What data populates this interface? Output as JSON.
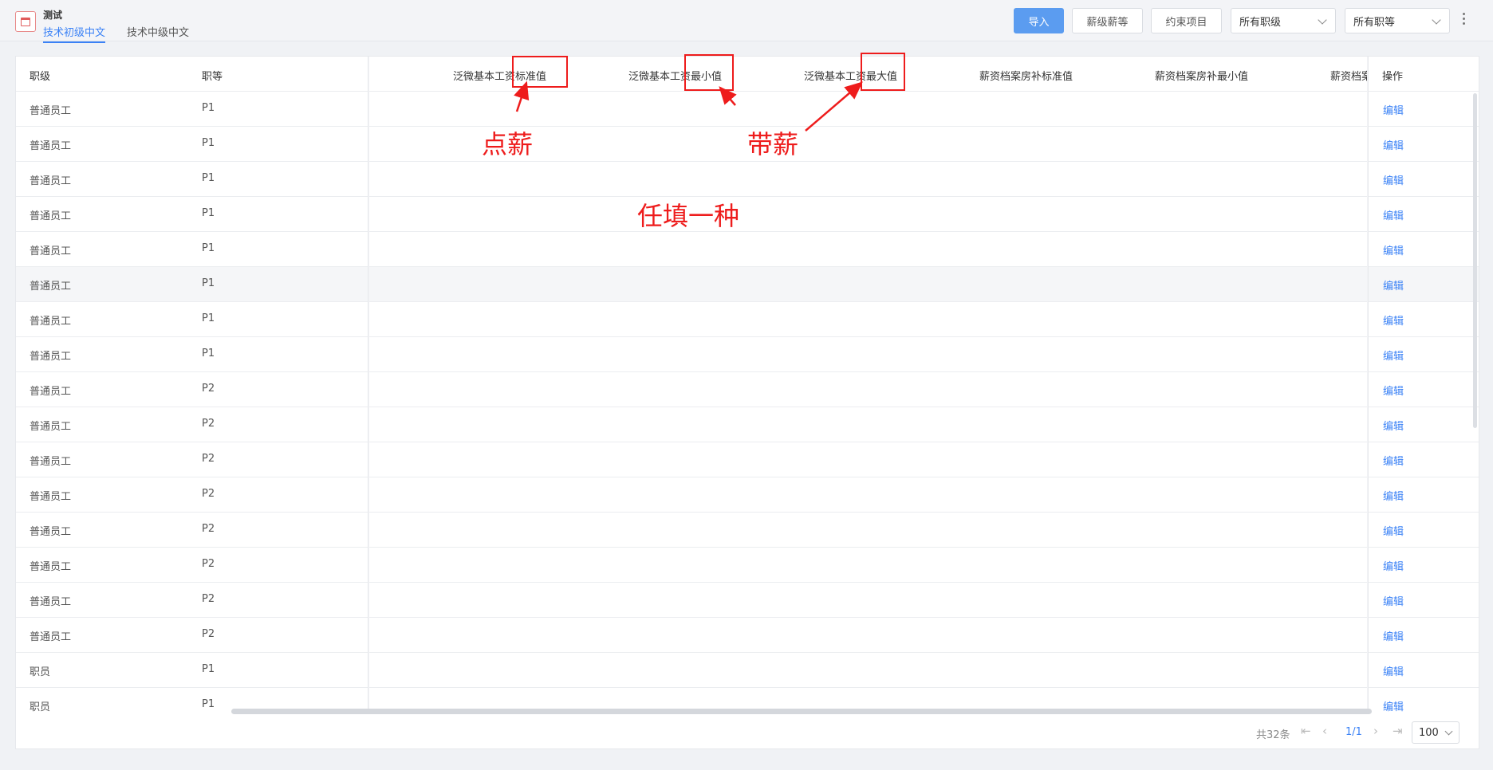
{
  "header": {
    "title": "测试",
    "tabs": [
      {
        "label": "技术初级中文",
        "active": true
      },
      {
        "label": "技术中级中文",
        "active": false
      }
    ],
    "buttons": {
      "import": "导入",
      "salary_grade": "薪级薪等",
      "constraint": "约束项目"
    },
    "filters": {
      "rank": "所有职级",
      "grade": "所有职等"
    }
  },
  "table": {
    "columns": [
      "职级",
      "职等",
      "泛微基本工资标准值",
      "泛微基本工资最小值",
      "泛微基本工资最大值",
      "薪资档案房补标准值",
      "薪资档案房补最小值",
      "薪资档案",
      "操作"
    ],
    "edit_label": "编辑",
    "rows": [
      {
        "rank": "普通员工",
        "grade": "P1"
      },
      {
        "rank": "普通员工",
        "grade": "P1"
      },
      {
        "rank": "普通员工",
        "grade": "P1"
      },
      {
        "rank": "普通员工",
        "grade": "P1"
      },
      {
        "rank": "普通员工",
        "grade": "P1"
      },
      {
        "rank": "普通员工",
        "grade": "P1"
      },
      {
        "rank": "普通员工",
        "grade": "P1"
      },
      {
        "rank": "普通员工",
        "grade": "P1"
      },
      {
        "rank": "普通员工",
        "grade": "P2"
      },
      {
        "rank": "普通员工",
        "grade": "P2"
      },
      {
        "rank": "普通员工",
        "grade": "P2"
      },
      {
        "rank": "普通员工",
        "grade": "P2"
      },
      {
        "rank": "普通员工",
        "grade": "P2"
      },
      {
        "rank": "普通员工",
        "grade": "P2"
      },
      {
        "rank": "普通员工",
        "grade": "P2"
      },
      {
        "rank": "普通员工",
        "grade": "P2"
      },
      {
        "rank": "职员",
        "grade": "P1"
      },
      {
        "rank": "职员",
        "grade": "P1"
      }
    ],
    "highlighted_row": 5
  },
  "pagination": {
    "total": "共32条",
    "page": "1/1",
    "page_size": "100"
  },
  "annotations": {
    "point_salary": "点薪",
    "band_salary": "带薪",
    "fill_one": "任填一种",
    "color": "#ee1c1c"
  },
  "icons": [
    "app-icon",
    "chevron-down-icon",
    "more-vertical-icon",
    "first-page-icon",
    "prev-page-icon",
    "next-page-icon",
    "last-page-icon"
  ]
}
